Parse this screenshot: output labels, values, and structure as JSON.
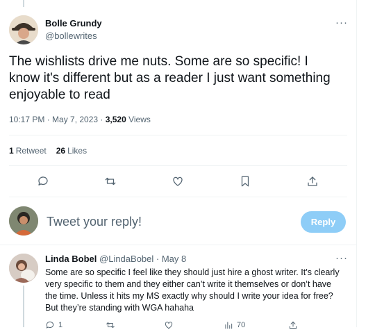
{
  "tweet": {
    "author_name": "Bolle Grundy",
    "author_handle": "@bollewrites",
    "more_label": "···",
    "text": "The wishlists drive me nuts. Some are so specific! I know it's different but as a reader I just want something enjoyable to read",
    "time": "10:17 PM · May 7, 2023 · ",
    "views_count": "3,520",
    "views_label": " Views",
    "retweets_count": "1",
    "retweets_label": "Retweet",
    "likes_count": "26",
    "likes_label": "Likes"
  },
  "actions": [
    {
      "name": "reply-icon"
    },
    {
      "name": "retweet-icon"
    },
    {
      "name": "like-icon"
    },
    {
      "name": "bookmark-icon"
    },
    {
      "name": "share-icon"
    }
  ],
  "composer": {
    "placeholder": "Tweet your reply!",
    "button_label": "Reply",
    "button_color": "#8ecdf7"
  },
  "reply": {
    "author_name": "Linda Bobel",
    "author_handle": "@LindaBobel",
    "separator": " · ",
    "date": "May 8",
    "more_label": "···",
    "text": "Some are so specific I feel like they should just hire a ghost writer. It’s clearly very specific to them and they either can’t write it themselves or don’t have the time. Unless it hits my MS exactly why should I write your idea for free? But they’re  standing with WGA hahaha",
    "reply_count": "1",
    "views_count": "70"
  }
}
